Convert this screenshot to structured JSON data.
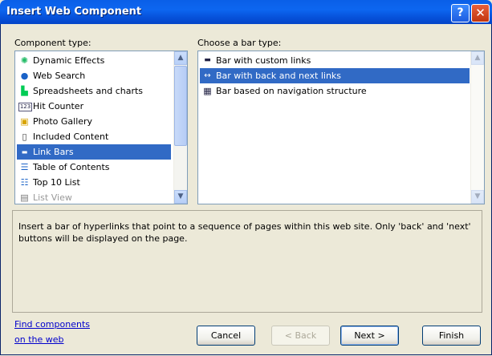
{
  "window": {
    "title": "Insert Web Component",
    "help_glyph": "?",
    "close_glyph": "✕"
  },
  "left": {
    "label": "Component type:",
    "items": [
      {
        "label": "Dynamic Effects",
        "icon": "dynamic-effects-icon"
      },
      {
        "label": "Web Search",
        "icon": "globe-icon"
      },
      {
        "label": "Spreadsheets and charts",
        "icon": "chart-icon"
      },
      {
        "label": "Hit Counter",
        "icon": "counter-icon",
        "badge": "123"
      },
      {
        "label": "Photo Gallery",
        "icon": "photo-icon"
      },
      {
        "label": "Included Content",
        "icon": "page-icon"
      },
      {
        "label": "Link Bars",
        "icon": "linkbar-icon"
      },
      {
        "label": "Table of Contents",
        "icon": "toc-icon"
      },
      {
        "label": "Top 10 List",
        "icon": "list-icon"
      },
      {
        "label": "List View",
        "icon": "listview-icon"
      }
    ],
    "selected": "Link Bars"
  },
  "right": {
    "label": "Choose a bar type:",
    "items": [
      {
        "label": "Bar with custom links",
        "icon": "custom-links-icon"
      },
      {
        "label": "Bar with back and next links",
        "icon": "back-next-icon"
      },
      {
        "label": "Bar based on navigation structure",
        "icon": "nav-structure-icon"
      }
    ],
    "selected": "Bar with back and next links"
  },
  "description": "Insert a bar of hyperlinks that point to a sequence of pages within this web site.  Only 'back' and 'next' buttons will be displayed on the page.",
  "footer": {
    "link_line1": "Find components",
    "link_line2": "on the web",
    "cancel": "Cancel",
    "back": "< Back",
    "next": "Next >",
    "finish": "Finish"
  },
  "colors": {
    "title_bar": "#0A5FE8",
    "selection": "#316AC5",
    "dialog_bg": "#ECE9D8"
  }
}
